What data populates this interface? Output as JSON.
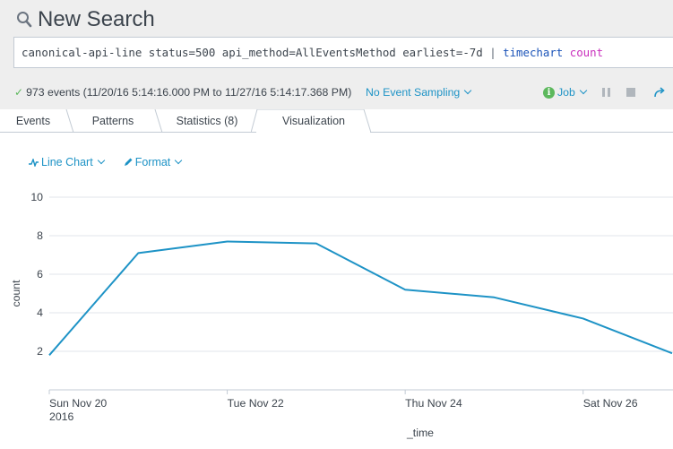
{
  "header": {
    "title": "New Search",
    "search_icon": "search-icon"
  },
  "search": {
    "query_base": "canonical-api-line status=500 api_method=AllEventsMethod earliest=-7d ",
    "query_pipe": "|",
    "query_command": "timechart",
    "query_function": "count",
    "colors": {
      "command": "#1a53b8",
      "function": "#c92fbd"
    }
  },
  "status": {
    "event_count": "973 events",
    "time_range": "(11/20/16 5:14:16.000 PM to 11/27/16 5:14:17.368 PM)",
    "sampling_label": "No Event Sampling",
    "job_label": "Job",
    "icons": [
      "check-icon",
      "info-icon",
      "pause-icon",
      "stop-icon",
      "share-icon"
    ]
  },
  "tabs": [
    {
      "label": "Events",
      "active": false
    },
    {
      "label": "Patterns",
      "active": false
    },
    {
      "label": "Statistics (8)",
      "active": false
    },
    {
      "label": "Visualization",
      "active": true
    }
  ],
  "viz_toolbar": {
    "chart_type_label": "Line Chart",
    "format_label": "Format"
  },
  "colors": {
    "accent": "#1e93c6",
    "line": "#1e93c6",
    "ok": "#5cb85c"
  },
  "chart_data": {
    "type": "line",
    "xlabel": "_time",
    "ylabel": "count",
    "ylim": [
      0,
      10
    ],
    "yticks": [
      2,
      4,
      6,
      8,
      10
    ],
    "grid": true,
    "legend": "none",
    "x": [
      "2016-11-20",
      "2016-11-21",
      "2016-11-22",
      "2016-11-23",
      "2016-11-24",
      "2016-11-25",
      "2016-11-26",
      "2016-11-27"
    ],
    "xticks": [
      {
        "date": "2016-11-20",
        "label": "Sun Nov 20",
        "sublabel": "2016"
      },
      {
        "date": "2016-11-22",
        "label": "Tue Nov 22",
        "sublabel": ""
      },
      {
        "date": "2016-11-24",
        "label": "Thu Nov 24",
        "sublabel": ""
      },
      {
        "date": "2016-11-26",
        "label": "Sat Nov 26",
        "sublabel": ""
      }
    ],
    "series": [
      {
        "values": [
          1.8,
          7.1,
          7.7,
          7.6,
          5.2,
          4.8,
          3.7,
          1.9
        ]
      }
    ]
  }
}
